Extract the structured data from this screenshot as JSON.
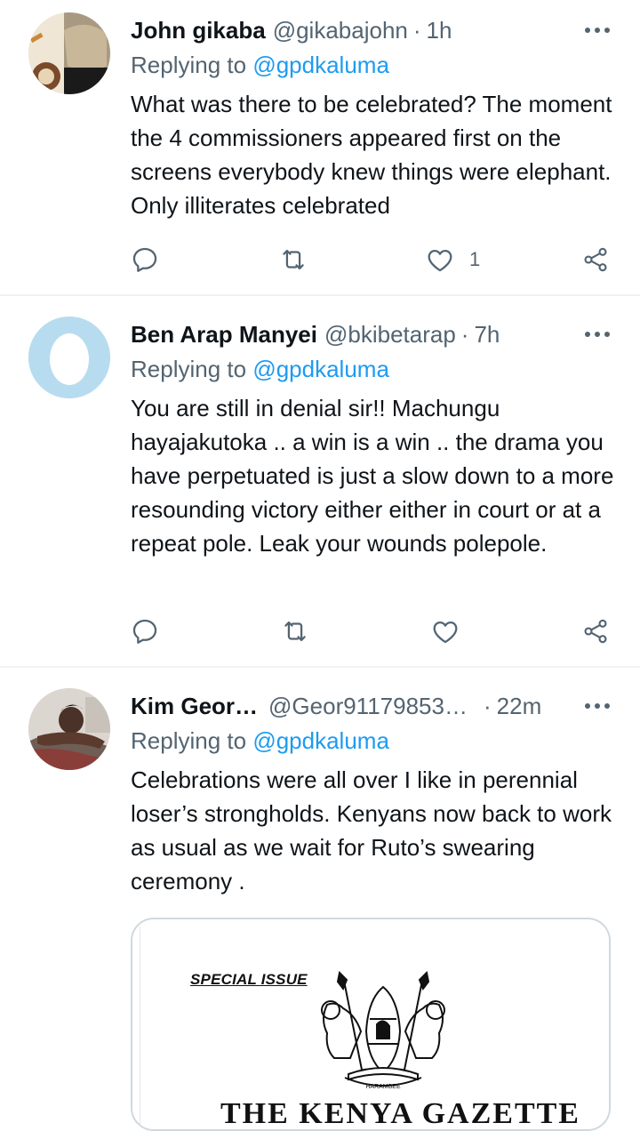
{
  "tweets": [
    {
      "name": "John gikaba",
      "handle": "@gikabajohn",
      "time": "1h",
      "replying_prefix": "Replying to ",
      "replying_to": "@gpdkaluma",
      "text": "What was there to be celebrated? The moment the 4 commissioners appeared first on the screens everybody knew things were elephant. Only illiterates celebrated",
      "like_count": "1"
    },
    {
      "name": "Ben Arap Manyei",
      "handle": "@bkibetarap",
      "time": "7h",
      "replying_prefix": "Replying to ",
      "replying_to": "@gpdkaluma",
      "text": "You are still in denial sir!! Machungu hayajakutoka .. a win is a win .. the drama you have perpetuated is just a slow down to a more resounding victory either either in court or at a repeat pole. Leak your wounds polepole."
    },
    {
      "name": "Kim Geor…",
      "handle": "@Geor91179853…",
      "time": "22m",
      "replying_prefix": "Replying to ",
      "replying_to": "@gpdkaluma",
      "text": "Celebrations were all over I like in perennial loser’s strongholds. Kenyans now back to work as usual as we wait for Ruto’s swearing ceremony .",
      "media": {
        "special_issue": "SPECIAL ISSUE",
        "gazette_title": "THE KENYA GAZETTE",
        "motto": "HARAMBEE"
      }
    }
  ],
  "separator": "·",
  "colors": {
    "accent": "#1d9bf0",
    "secondary_text": "#536471",
    "divider": "#eff3f4",
    "egg_bg": "#b8dcef"
  }
}
